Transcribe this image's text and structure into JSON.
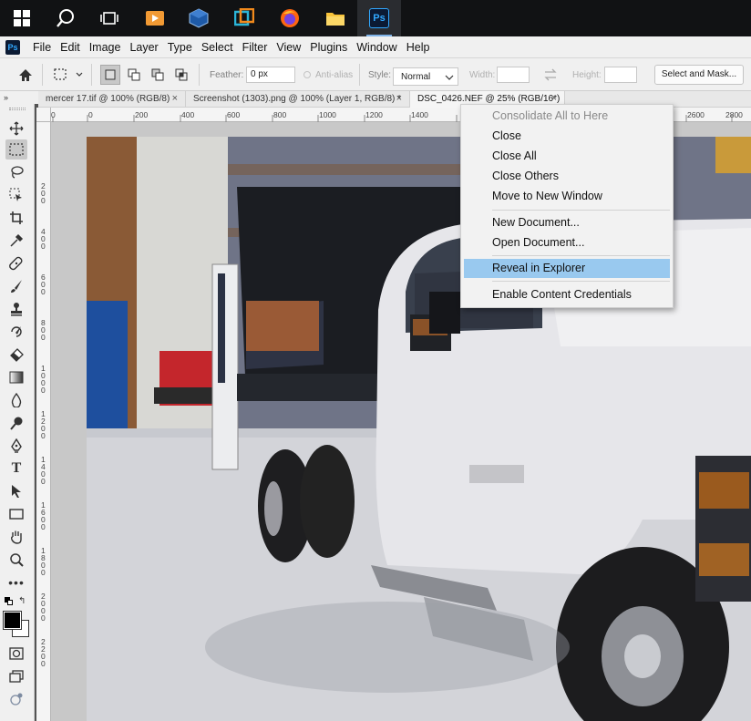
{
  "taskbar": {
    "apps": [
      {
        "name": "start",
        "icon": "windows-logo-icon"
      },
      {
        "name": "search",
        "icon": "search-icon"
      },
      {
        "name": "task-view",
        "icon": "task-view-icon"
      },
      {
        "name": "media-player",
        "icon": "media-player-icon"
      },
      {
        "name": "virtualbox",
        "icon": "virtualbox-icon"
      },
      {
        "name": "snip",
        "icon": "snip-icon"
      },
      {
        "name": "firefox",
        "icon": "firefox-icon"
      },
      {
        "name": "file-explorer",
        "icon": "folder-icon"
      },
      {
        "name": "photoshop",
        "icon": "photoshop-icon",
        "label": "Ps",
        "active": true
      }
    ]
  },
  "app": {
    "logo": "Ps"
  },
  "menu": [
    "File",
    "Edit",
    "Image",
    "Layer",
    "Type",
    "Select",
    "Filter",
    "View",
    "Plugins",
    "Window",
    "Help"
  ],
  "options": {
    "feather_label": "Feather:",
    "feather_value": "0 px",
    "antialias_label": "Anti-alias",
    "style_label": "Style:",
    "style_value": "Normal",
    "width_label": "Width:",
    "height_label": "Height:",
    "select_mask_label": "Select and Mask..."
  },
  "collapse": "»",
  "tabs": [
    {
      "label": "mercer 17.tif @ 100% (RGB/8)",
      "active": false
    },
    {
      "label": "Screenshot (1303).png @ 100% (Layer 1, RGB/8) *",
      "active": false
    },
    {
      "label": "DSC_0426.NEF @ 25% (RGB/16*)",
      "active": true
    }
  ],
  "ruler": {
    "h_ticks": [
      "0",
      "0",
      "200",
      "400",
      "600",
      "800",
      "1000",
      "1200",
      "1400",
      "2600",
      "2800"
    ],
    "v_ticks": [
      "2\n0\n0",
      "4\n0\n0",
      "6\n0\n0",
      "8\n0\n0",
      "1\n0\n0\n0",
      "1\n2\n0\n0",
      "1\n4\n0\n0",
      "1\n6\n0\n0",
      "1\n8\n0\n0",
      "2\n0\n0\n0",
      "2\n2\n0\n0"
    ]
  },
  "context_menu": {
    "items": [
      {
        "label": "Consolidate All to Here",
        "disabled": true
      },
      {
        "label": "Close"
      },
      {
        "label": "Close All"
      },
      {
        "label": "Close Others"
      },
      {
        "label": "Move to New Window"
      },
      {
        "label": "New Document..."
      },
      {
        "label": "Open Document..."
      },
      {
        "label": "Reveal in Explorer",
        "hover": true
      },
      {
        "label": "Enable Content Credentials"
      }
    ]
  },
  "colors": {
    "ps_blue": "#31a8ff",
    "taskbar": "#111214",
    "menu_hover": "#99c9ef",
    "chrome": "#f0f0f0"
  }
}
